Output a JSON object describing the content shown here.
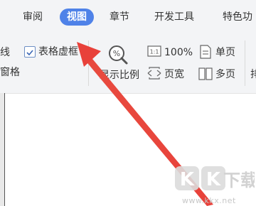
{
  "tabs": [
    {
      "label": "审阅"
    },
    {
      "label": "视图",
      "active": true
    },
    {
      "label": "章节"
    },
    {
      "label": "开发工具"
    },
    {
      "label": "特色功"
    }
  ],
  "ribbon": {
    "left_cut_top": "线",
    "left_cut_bottom": "窗格",
    "table_grid_label": "表格虚框",
    "zoom_ratio_label": "显示比例",
    "zoom_100_label": "100%",
    "page_width_label": "页宽",
    "single_page_label": "单页",
    "multi_page_label": "多页",
    "right_cut_label": "排",
    "table_grid_checked": true
  },
  "watermark": {
    "logo_text": "KK下载",
    "url": "www.kkx.net"
  },
  "colors": {
    "active_tab": "#4f82e8",
    "arrow": "#e8413a",
    "ribbon_bg": "#f3f4f6"
  }
}
